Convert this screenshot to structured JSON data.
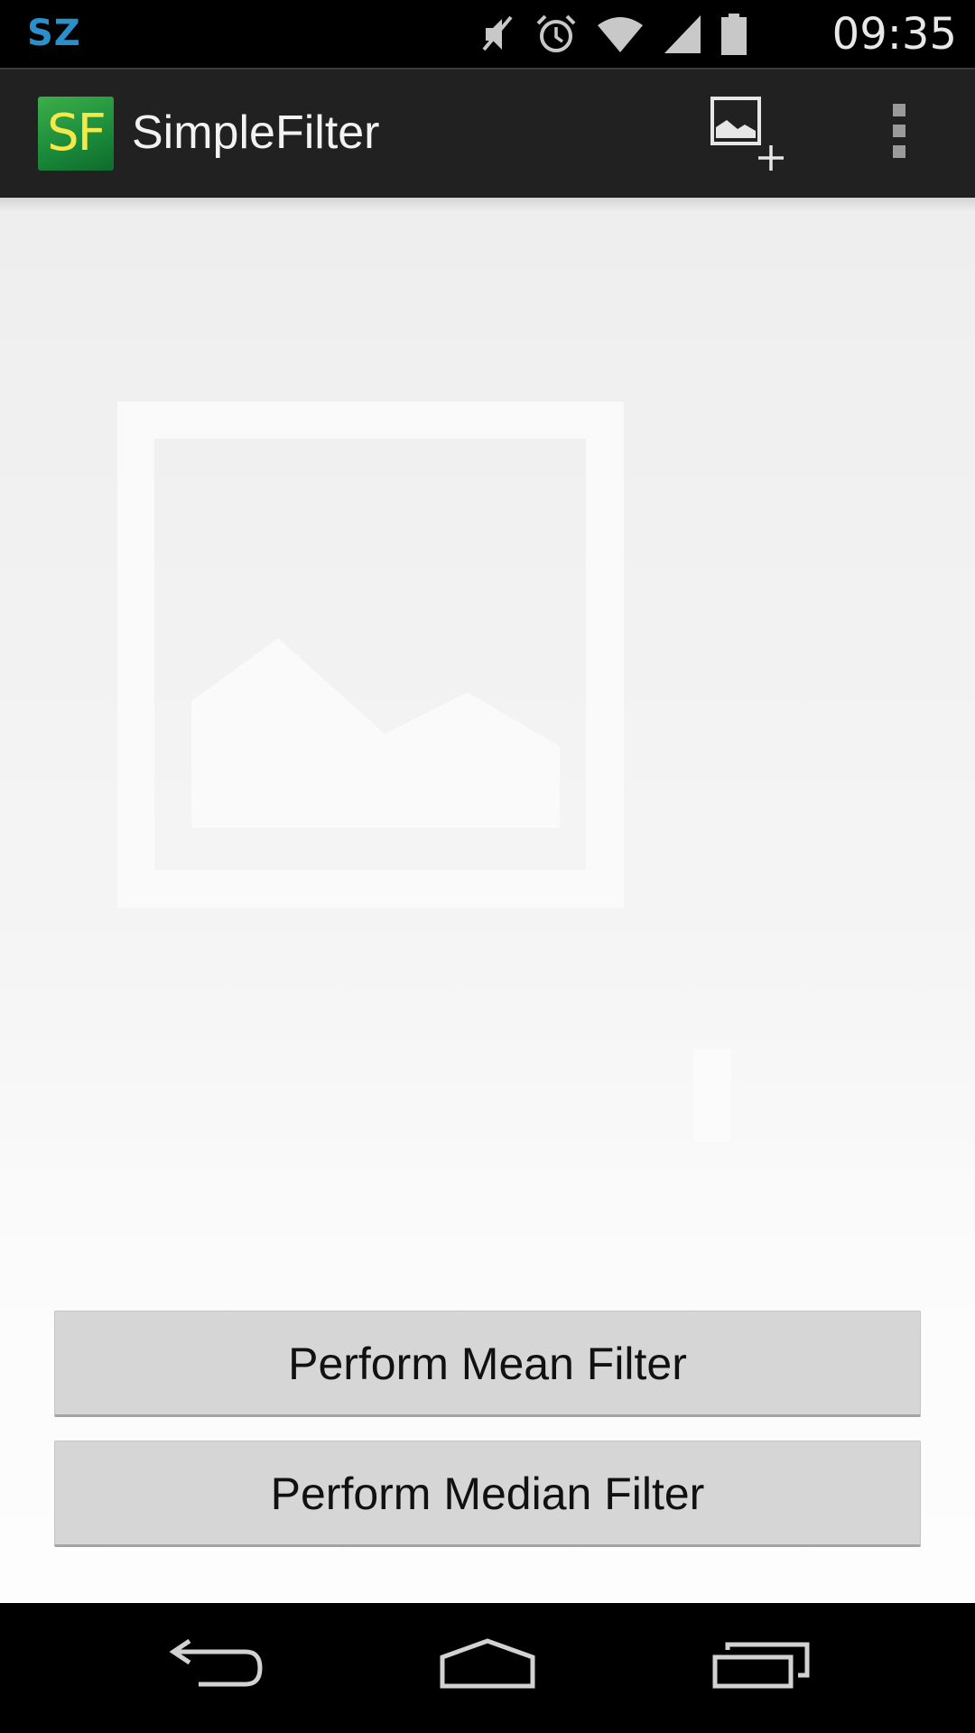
{
  "status_bar": {
    "carrier": "SZ",
    "time": "09:35",
    "icons": [
      "mute-icon",
      "alarm-icon",
      "wifi-icon",
      "signal-icon",
      "battery-icon"
    ]
  },
  "action_bar": {
    "logo_text": "SF",
    "title": "SimpleFilter",
    "actions": [
      "add-image-icon",
      "overflow-menu-icon"
    ]
  },
  "main": {
    "placeholder_icon": "add-image-placeholder-icon",
    "buttons": {
      "mean": "Perform Mean Filter",
      "median": "Perform Median Filter"
    }
  },
  "nav_bar": {
    "icons": [
      "back-icon",
      "home-icon",
      "recent-apps-icon"
    ]
  },
  "colors": {
    "carrier": "#2c8fc9",
    "action_bar_bg": "#212121",
    "logo_green": "#1a8a3a",
    "logo_text": "#f4e84a",
    "button_bg": "#d6d6d6"
  }
}
